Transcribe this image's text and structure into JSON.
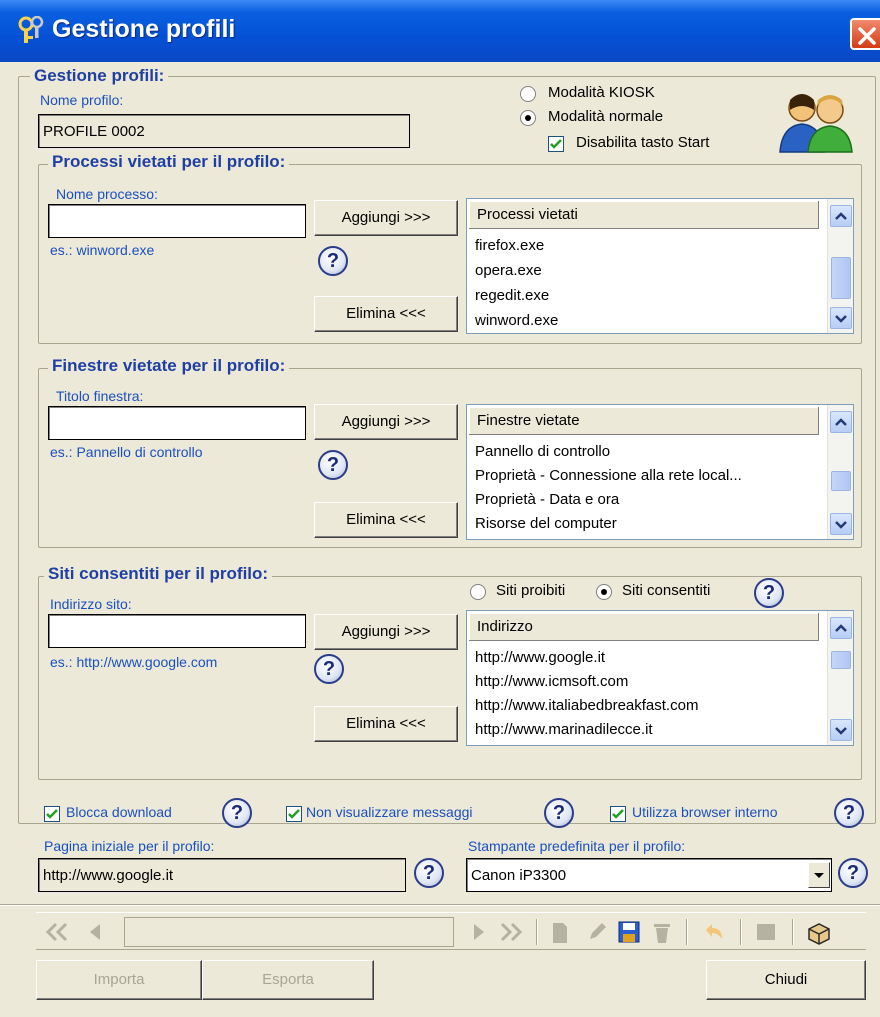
{
  "window": {
    "title": "Gestione profili"
  },
  "profile_group": {
    "legend": "Gestione profili:",
    "name_label": "Nome profilo:",
    "name_value": "PROFILE 0002",
    "mode_kiosk": "Modalità KIOSK",
    "mode_normal": "Modalità normale",
    "disable_start": "Disabilita tasto Start"
  },
  "processes": {
    "legend": "Processi vietati per il profilo:",
    "field_label": "Nome processo:",
    "example": "es.: winword.exe",
    "add_label": "Aggiungi >>>",
    "remove_label": "Elimina <<<",
    "list_header": "Processi vietati",
    "items": [
      "firefox.exe",
      "opera.exe",
      "regedit.exe",
      "winword.exe"
    ]
  },
  "windows": {
    "legend": "Finestre vietate per il profilo:",
    "field_label": "Titolo finestra:",
    "example": "es.: Pannello di controllo",
    "add_label": "Aggiungi >>>",
    "remove_label": "Elimina <<<",
    "list_header": "Finestre vietate",
    "items": [
      "Pannello di controllo",
      "Proprietà - Connessione alla rete local...",
      "Proprietà - Data e ora",
      "Risorse del computer"
    ]
  },
  "sites": {
    "legend": "Siti consentiti per il profilo:",
    "field_label": "Indirizzo sito:",
    "example": "es.: http://www.google.com",
    "radio_forbidden": "Siti proibiti",
    "radio_allowed": "Siti consentiti",
    "add_label": "Aggiungi >>>",
    "remove_label": "Elimina <<<",
    "list_header": "Indirizzo",
    "items": [
      "http://www.google.it",
      "http://www.icmsoft.com",
      "http://www.italiabedbreakfast.com",
      "http://www.marinadilecce.it"
    ]
  },
  "options": {
    "block_download": "Blocca download",
    "no_messages": "Non visualizzare messaggi",
    "internal_browser": "Utilizza browser interno",
    "home_label": "Pagina iniziale per il profilo:",
    "home_value": "http://www.google.it",
    "printer_label": "Stampante predefinita per il profilo:",
    "printer_value": "Canon iP3300"
  },
  "help_glyph": "?",
  "footer": {
    "import_label": "Importa",
    "export_label": "Esporta",
    "close_label": "Chiudi"
  },
  "colors": {
    "title_blue": "#0551d6",
    "legend_blue": "#1f3fa4",
    "label_blue": "#1a4fc2",
    "window_bg": "#ece9d8"
  }
}
